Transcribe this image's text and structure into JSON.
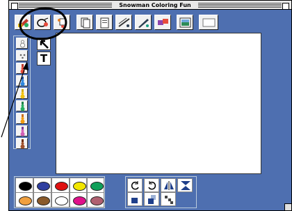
{
  "window": {
    "title": "Snowman Coloring Fun"
  },
  "toolbar": {
    "buttons": [
      {
        "name": "paint-palette-button",
        "icon": "paint-palette-icon"
      },
      {
        "name": "color-picker-button",
        "icon": "color-picker-icon"
      },
      {
        "name": "stamp-button",
        "icon": "stamp-icon"
      },
      {
        "name": "copy-button",
        "icon": "copy-icon"
      },
      {
        "name": "paste-button",
        "icon": "paste-icon"
      },
      {
        "name": "line-tool-button",
        "icon": "line-tool-icon"
      },
      {
        "name": "pencil-tool-button",
        "icon": "pencil-tool-icon"
      },
      {
        "name": "eraser-tool-button",
        "icon": "eraser-tool-icon"
      },
      {
        "name": "picture-button",
        "icon": "picture-icon"
      },
      {
        "name": "blank-page-button",
        "icon": "blank-page-icon"
      }
    ]
  },
  "tools": {
    "text_tool_label": "T",
    "arrow_tool": "arrow-cursor-icon"
  },
  "stickers": [
    "snowman-white",
    "dots",
    "red-hat",
    "blue-hat",
    "yellow-hat",
    "green-hat",
    "orange-hat",
    "purple-hat",
    "brown-hat"
  ],
  "palette": {
    "colors": [
      "#000000",
      "#2f3fa0",
      "#e01010",
      "#f2e600",
      "#10a05a",
      "#f0a040",
      "#8a5a2a",
      "#ffffff",
      "#e0108a",
      "#b06070"
    ]
  },
  "transform_tools": [
    "rotate-left-icon",
    "rotate-right-icon",
    "flip-horizontal-icon",
    "flip-vertical-icon",
    "bring-front-icon",
    "send-back-icon",
    "scatter-icon"
  ],
  "colors": {
    "window_bg": "#4e6fb0",
    "canvas_bg": "#ffffff"
  }
}
